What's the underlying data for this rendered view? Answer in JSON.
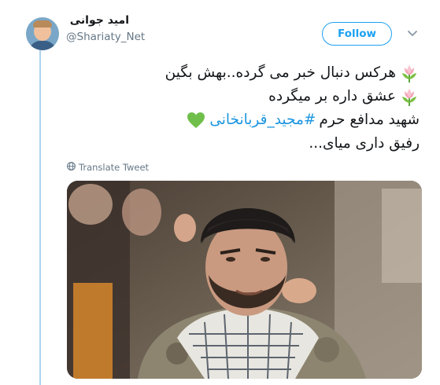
{
  "author": {
    "display_name": "امید جوانی",
    "handle": "@Shariaty_Net"
  },
  "follow_label": "Follow",
  "tweet": {
    "line1": "هرکس دنبال خبر می گرده..بهش بگین",
    "line2": "عشق داره بر میگرده",
    "line3_prefix": "شهید مدافع حرم",
    "line3_hashtag": "#مجید_قربانخانی",
    "line4": "رفیق داری میای..."
  },
  "translate_label": "Translate Tweet",
  "icons": {
    "tulip": "tulip-emoji",
    "heart": "green-heart-emoji",
    "globe": "globe-icon",
    "caret": "chevron-down-icon"
  },
  "colors": {
    "accent": "#1da1f2",
    "hashtag": "#1b95e0",
    "secondary": "#657786",
    "thread": "#a9d3f0"
  }
}
